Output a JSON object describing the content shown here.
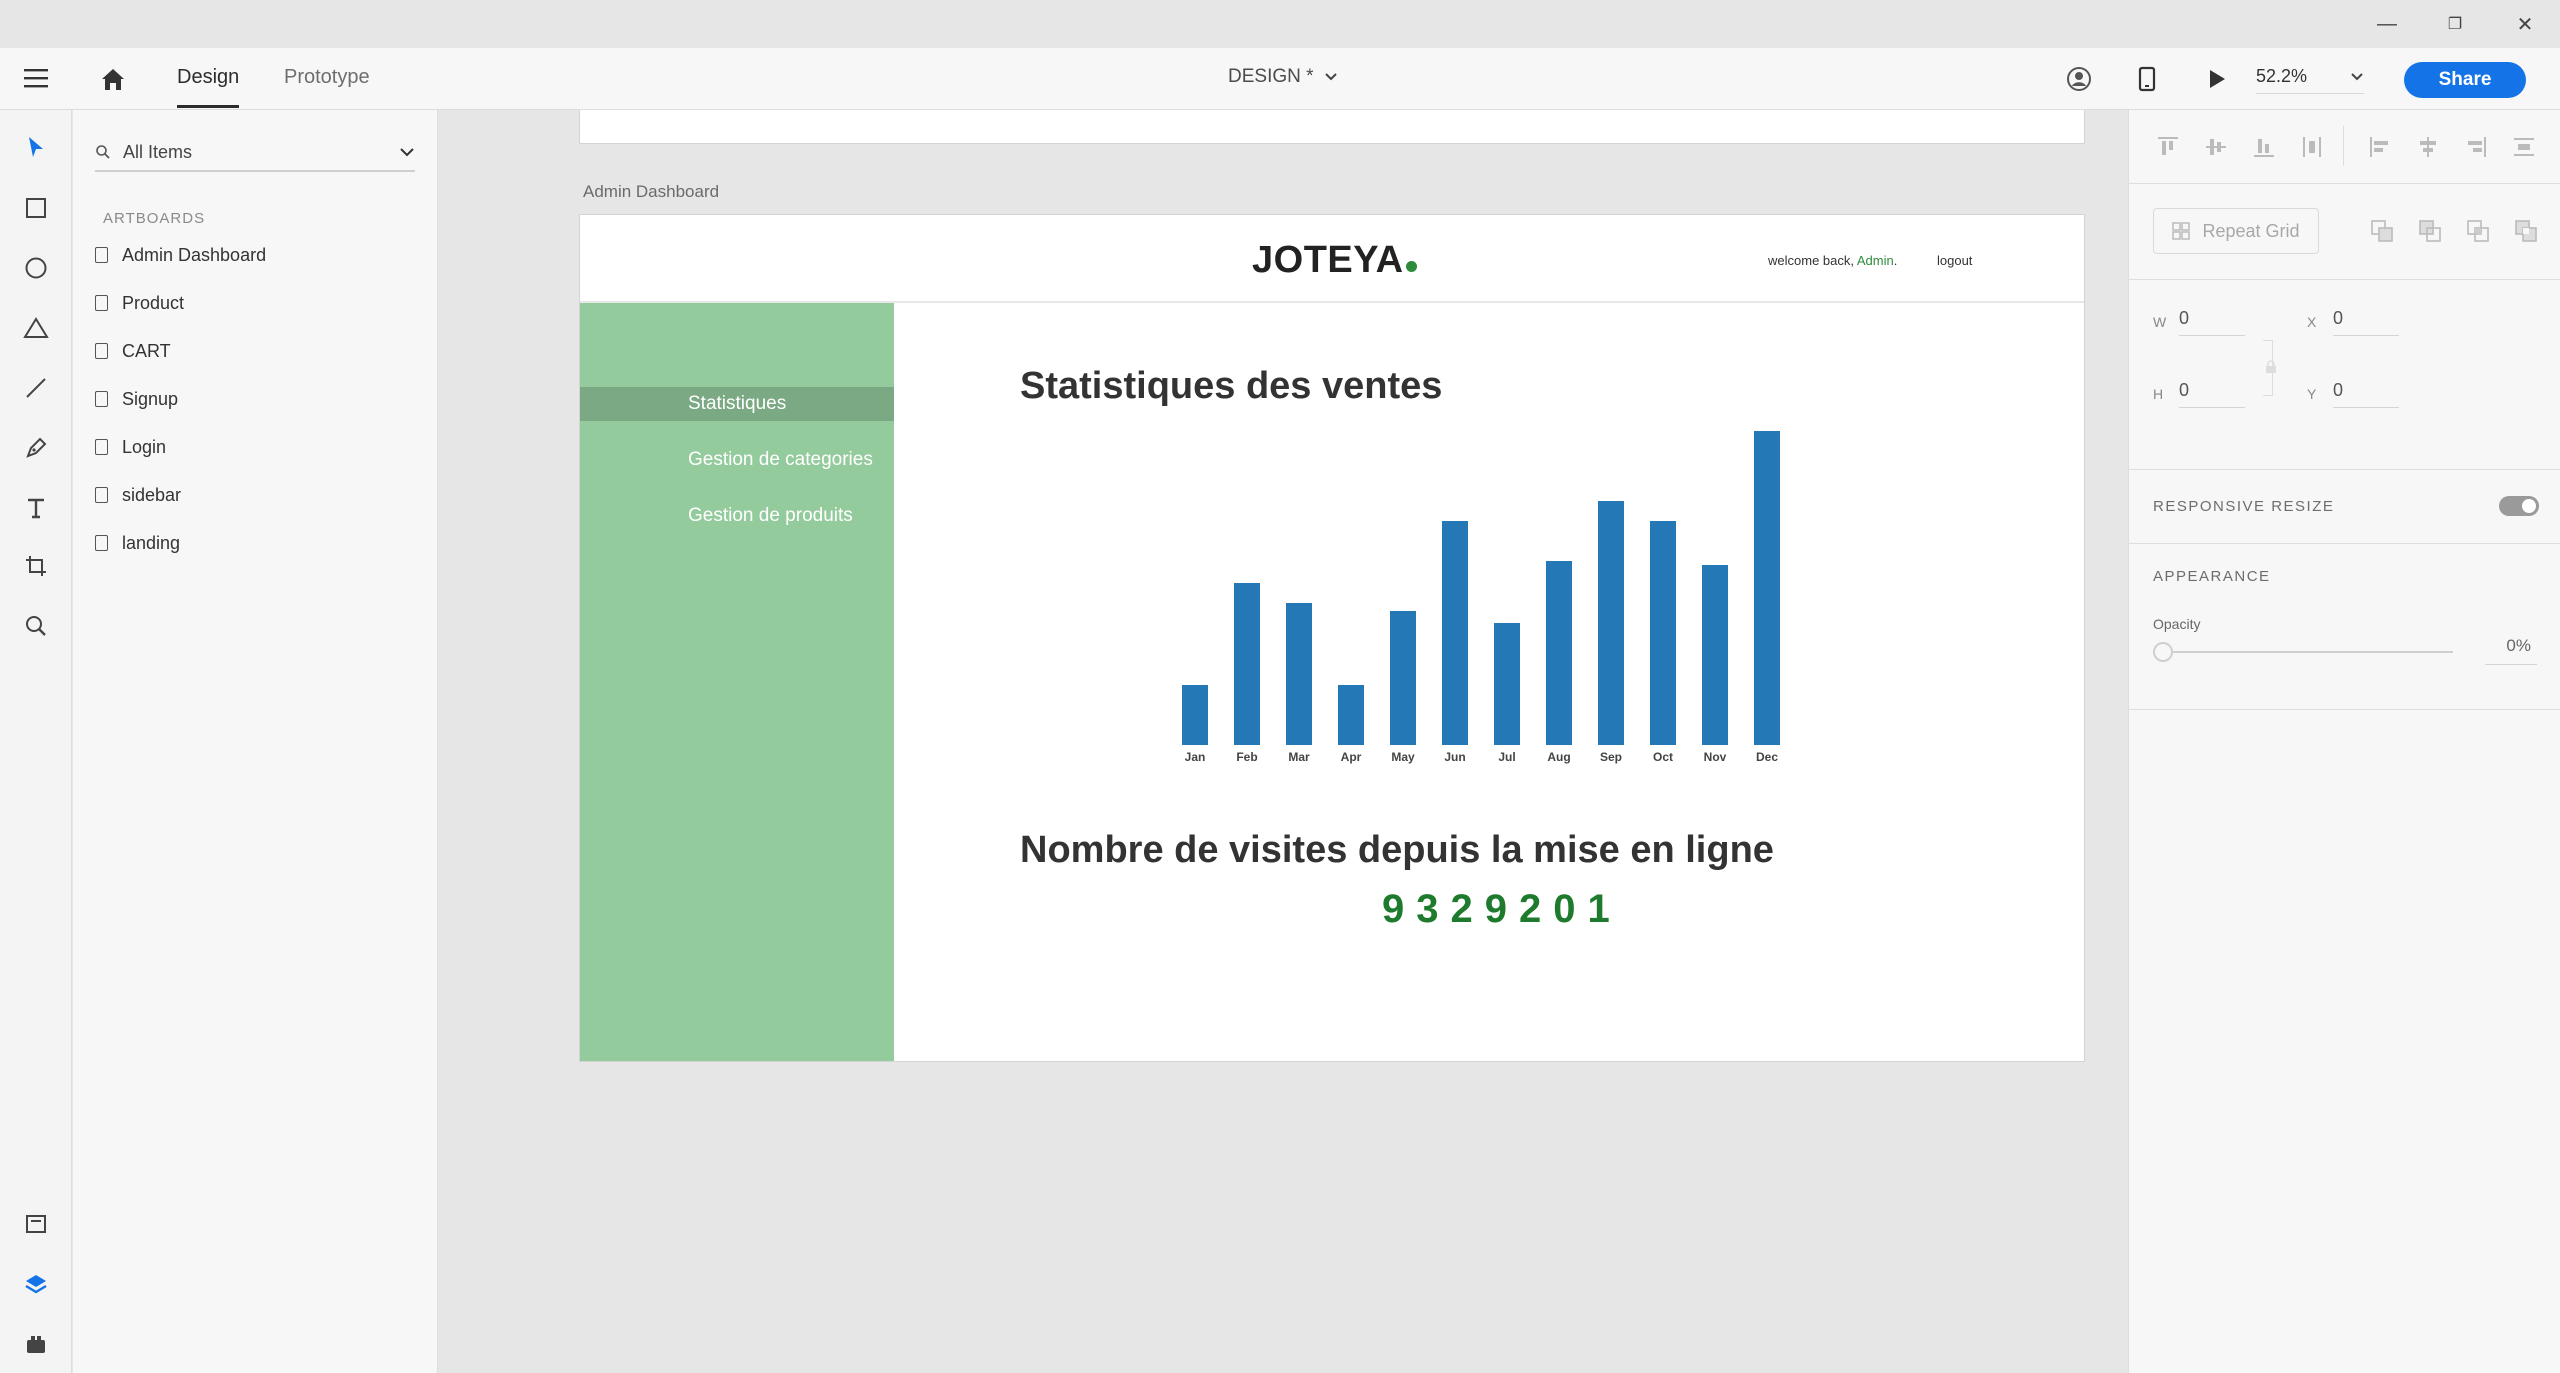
{
  "titlebar": {
    "minimize": "—",
    "restore": "❐",
    "close": "✕"
  },
  "appbar": {
    "tabs": [
      {
        "label": "Design"
      },
      {
        "label": "Prototype"
      }
    ],
    "document_title": "DESIGN *",
    "zoom": "52.2%",
    "share_label": "Share"
  },
  "layers": {
    "filter_label": "All Items",
    "section_label": "ARTBOARDS",
    "artboards": [
      {
        "label": "Admin Dashboard"
      },
      {
        "label": "Product"
      },
      {
        "label": "CART"
      },
      {
        "label": "Signup"
      },
      {
        "label": "Login"
      },
      {
        "label": "sidebar"
      },
      {
        "label": "landing"
      }
    ]
  },
  "canvas": {
    "artboard_label": "Admin Dashboard",
    "logo": "JOTEYA",
    "welcome_prefix": "welcome back, ",
    "welcome_user": "Admin",
    "welcome_suffix": ".",
    "logout": "logout",
    "nav": [
      {
        "label": "Statistiques"
      },
      {
        "label": "Gestion de categories"
      },
      {
        "label": "Gestion de produits"
      }
    ],
    "sales_title": "Statistiques des ventes",
    "visits_title": "Nombre de visites depuis la mise en ligne",
    "visits_value": "9329201"
  },
  "chart_data": {
    "type": "bar",
    "categories": [
      "Jan",
      "Feb",
      "Mar",
      "Apr",
      "May",
      "Jun",
      "Jul",
      "Aug",
      "Sep",
      "Oct",
      "Nov",
      "Dec"
    ],
    "values": [
      30,
      81,
      71,
      30,
      67,
      112,
      61,
      92,
      122,
      112,
      90,
      157
    ],
    "ylim": [
      0,
      160
    ],
    "grid": false,
    "color": "#2378b5"
  },
  "properties": {
    "repeat_grid_label": "Repeat Grid",
    "w_label": "W",
    "w_value": "0",
    "h_label": "H",
    "h_value": "0",
    "x_label": "X",
    "x_value": "0",
    "y_label": "Y",
    "y_value": "0",
    "responsive_label": "RESPONSIVE RESIZE",
    "appearance_label": "APPEARANCE",
    "opacity_label": "Opacity",
    "opacity_value": "0%"
  },
  "colors": {
    "accent": "#1473e6",
    "sidebar_green": "#94cb9c",
    "brand_green": "#2e8b3a",
    "bar_blue": "#2378b5"
  }
}
